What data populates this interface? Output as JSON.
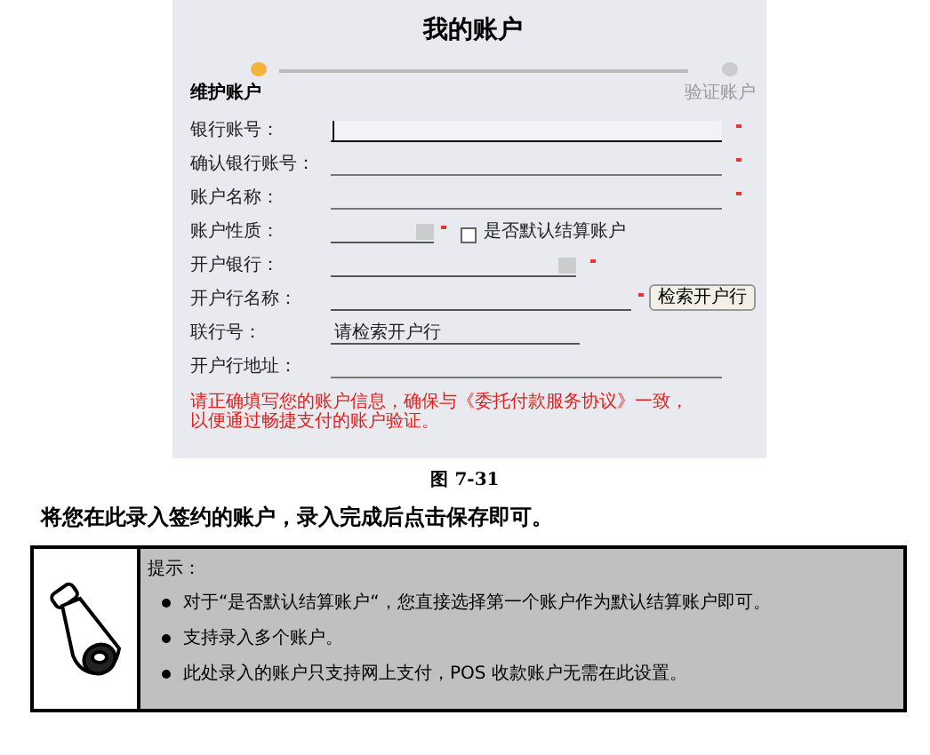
{
  "form": {
    "title": "我的账户",
    "steps": [
      {
        "label": "维护账户",
        "selected": true
      },
      {
        "label": "验证账户",
        "selected": false
      }
    ],
    "fields": [
      {
        "kind": "text",
        "label": "银行账号：",
        "required": true,
        "focused": true
      },
      {
        "kind": "text",
        "label": "确认银行账号：",
        "required": true,
        "focused": false
      },
      {
        "kind": "text",
        "label": "账户名称：",
        "required": true,
        "focused": false
      },
      {
        "kind": "select",
        "label": "账户性质：",
        "required": true,
        "checkbox": {
          "label": "是否默认结算账户",
          "checked": false
        }
      },
      {
        "kind": "select",
        "label": "开户银行：",
        "required": true
      },
      {
        "kind": "search",
        "label": "开户行名称：",
        "required": true,
        "button": "检索开户行"
      },
      {
        "kind": "readonly",
        "label": "联行号：",
        "value": "请检索开户行"
      },
      {
        "kind": "text",
        "label": "开户行地址：",
        "required": false,
        "focused": false
      }
    ],
    "note": [
      "请正确填写您的账户信息，确保与《委托付款服务协议》一致，",
      "以便通过畅捷支付的账户验证。"
    ]
  },
  "caption": "图 7-31",
  "paragraph": "将您在此录入签约的账户，录入完成后点击保存即可。",
  "tip": {
    "heading": "提示：",
    "items": [
      "对于“是否默认结算账户“，您直接选择第一个账户作为默认结算账户即可。",
      "支持录入多个账户。",
      "此处录入的账户只支持网上支付，POS 收款账户无需在此设置。"
    ]
  }
}
